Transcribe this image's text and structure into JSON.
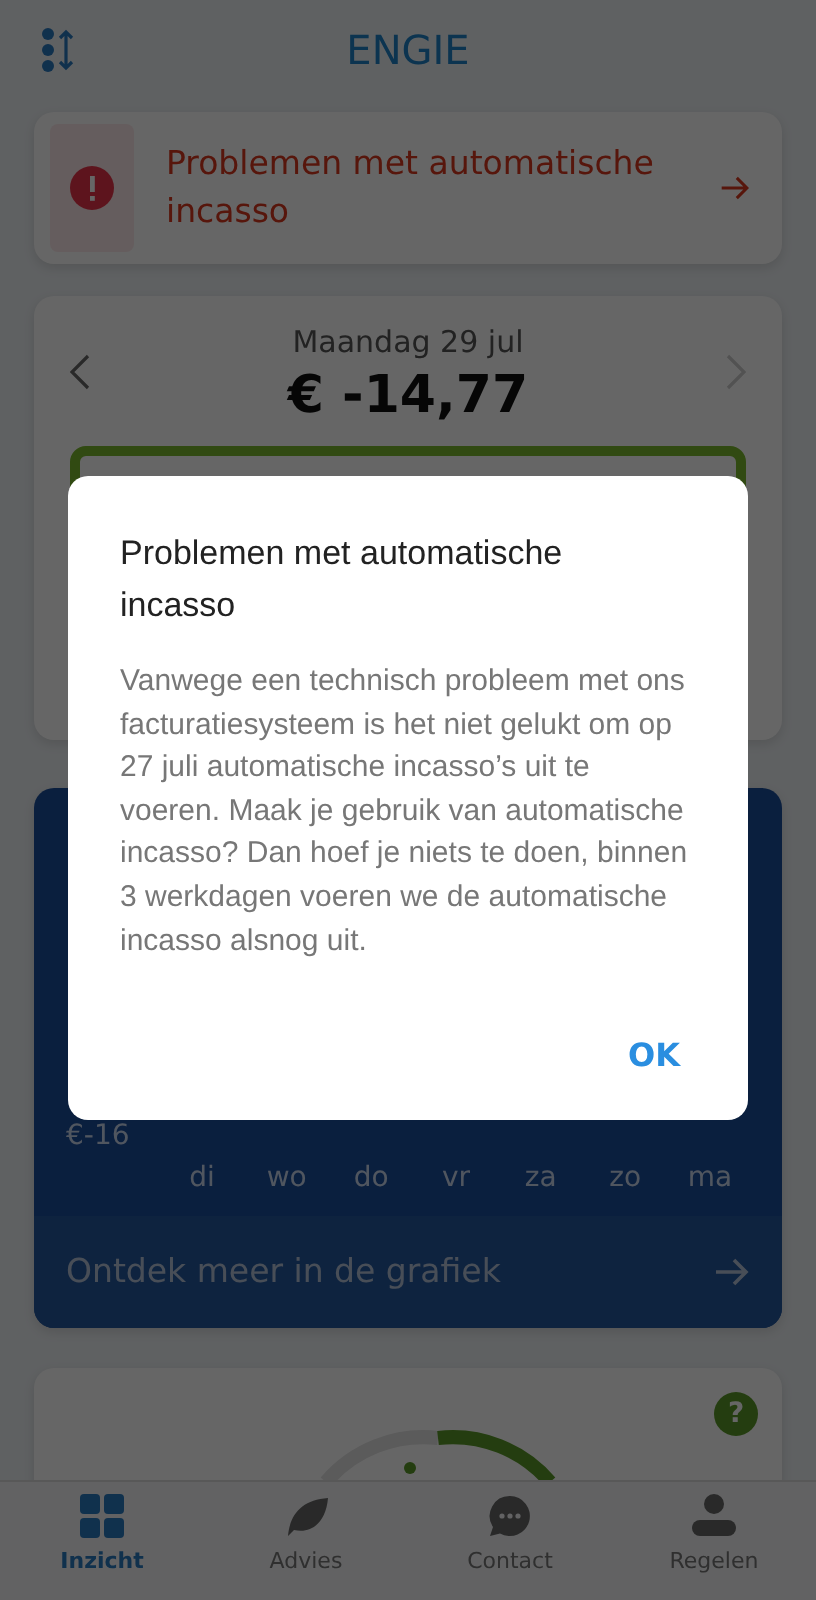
{
  "header": {
    "logo": "ENGIE"
  },
  "alert": {
    "text": "Problemen met automatische incasso"
  },
  "day_card": {
    "date": "Maandag 29 jul",
    "amount": "€ -14,77"
  },
  "chart_card": {
    "axis_label": "€-16",
    "days": [
      "di",
      "wo",
      "do",
      "vr",
      "za",
      "zo",
      "ma"
    ],
    "link": "Ontdek meer in de grafiek"
  },
  "gauge_card": {
    "help": "?"
  },
  "bottom_nav": [
    {
      "label": "Inzicht",
      "selected": true
    },
    {
      "label": "Advies",
      "selected": false
    },
    {
      "label": "Contact",
      "selected": false
    },
    {
      "label": "Regelen",
      "selected": false
    }
  ],
  "dialog": {
    "title": "Problemen met automatische incasso",
    "body": "Vanwege een technisch probleem met ons facturatiesysteem is het niet gelukt om op 27 juli automatische incasso’s uit te voeren. Maak je gebruik van automatische incasso? Dan hoef je niets te doen, binnen 3 werkdagen voeren we de automatische incasso alsnog uit.",
    "button": "OK"
  }
}
